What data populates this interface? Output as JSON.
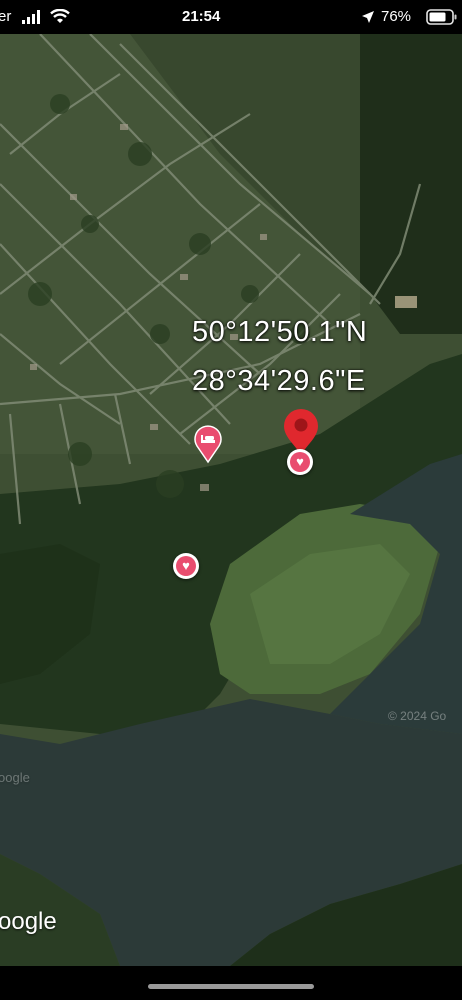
{
  "status_bar": {
    "carrier": "er",
    "time": "21:54",
    "battery": "76%",
    "icons": [
      "signal-icon",
      "wifi-icon",
      "location-arrow-icon",
      "battery-icon"
    ]
  },
  "map": {
    "coordinate_lat": "50°12'50.1\"N",
    "coordinate_lon": "28°34'29.6\"E",
    "copyright": "© 2024 Go",
    "watermark": "oogle",
    "watermark_faint": "oogle",
    "pin_color": "#e0282e",
    "poi_color": "#e94d6f",
    "markers": [
      "location-pin-icon",
      "favorite-heart-icon",
      "hotel-bed-icon",
      "favorite-heart-icon"
    ]
  }
}
